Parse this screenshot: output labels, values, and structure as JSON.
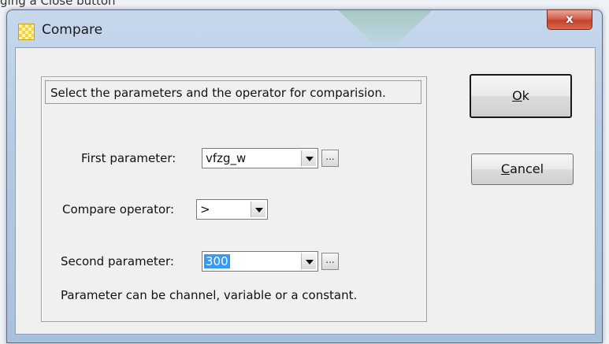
{
  "background": {
    "partial_text": "ging a Close button"
  },
  "window": {
    "title": "Compare",
    "close_label": "x"
  },
  "dialog": {
    "hint": "Select the parameters and the operator for comparision.",
    "first_parameter": {
      "label": "First parameter:",
      "value": "vfzg_w"
    },
    "compare_operator": {
      "label": "Compare operator:",
      "value": ">"
    },
    "second_parameter": {
      "label": "Second parameter:",
      "value": "300"
    },
    "footnote": "Parameter can be channel, variable or a constant.",
    "ellipsis_label": "..."
  },
  "buttons": {
    "ok": {
      "mnemonic": "O",
      "rest": "k"
    },
    "cancel": {
      "mnemonic": "C",
      "rest": "ancel"
    }
  }
}
